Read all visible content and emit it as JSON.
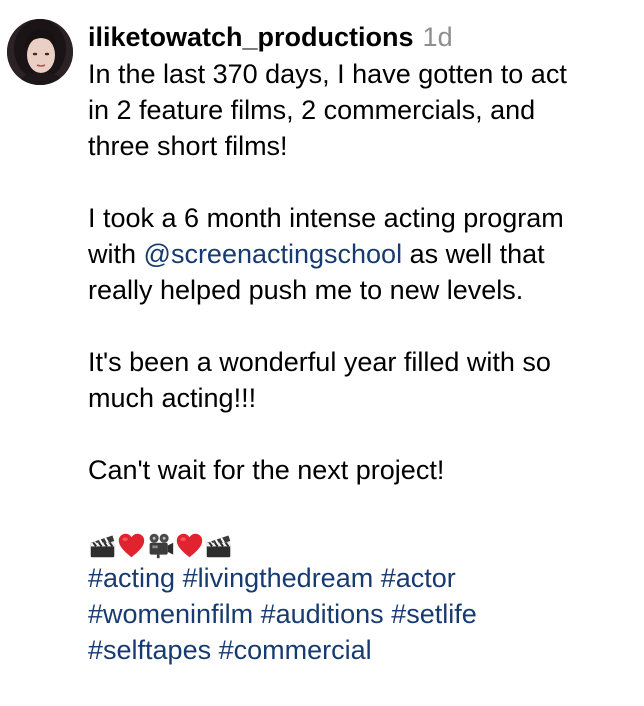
{
  "post": {
    "username": "iliketowatch_productions",
    "timestamp": "1d",
    "caption": {
      "line1": "In the last 370 days, I have gotten to act",
      "line2": "in 2 feature films, 2 commercials, and",
      "line3": "three short films!",
      "line4": "I took a 6 month intense acting program",
      "line5_prefix": "with ",
      "mention": "@screenactingschool",
      "line5_suffix": " as well that",
      "line6": "really helped push me to new levels.",
      "line7": "It's been a wonderful year filled with so",
      "line8": "much acting!!!",
      "line9": "Can't wait for the next project!"
    },
    "emojis": [
      "clapper-board",
      "red-heart",
      "movie-camera",
      "red-heart",
      "clapper-board"
    ],
    "hashtags": [
      [
        "#acting",
        "#livingthedream",
        "#actor"
      ],
      [
        "#womeninfilm",
        "#auditions",
        "#setlife"
      ],
      [
        "#selftapes",
        "#commercial"
      ]
    ]
  },
  "colors": {
    "link": "#173b70",
    "timestamp": "#8e8e8e",
    "text": "#000000"
  }
}
